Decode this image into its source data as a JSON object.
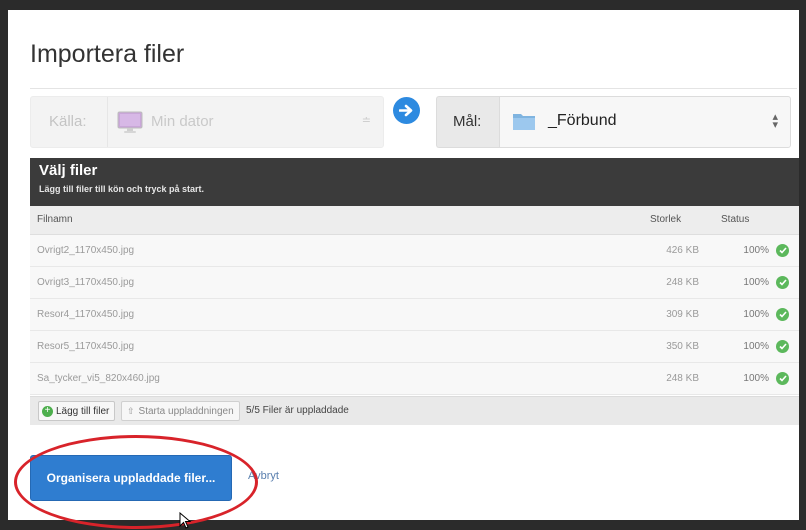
{
  "dialog": {
    "title": "Importera filer"
  },
  "source": {
    "label": "Källa:",
    "value": "Min dator",
    "caret": "≐"
  },
  "destination": {
    "label": "Mål:",
    "value": "_Förbund",
    "caret": "▴▾"
  },
  "file_panel": {
    "title": "Välj filer",
    "subtitle": "Lägg till filer till kön och tryck på start.",
    "columns": {
      "filename": "Filnamn",
      "size": "Storlek",
      "status": "Status"
    },
    "files": [
      {
        "name": "Ovrigt2_1170x450.jpg",
        "size": "426 KB",
        "status": "100%"
      },
      {
        "name": "Ovrigt3_1170x450.jpg",
        "size": "248 KB",
        "status": "100%"
      },
      {
        "name": "Resor4_1170x450.jpg",
        "size": "309 KB",
        "status": "100%"
      },
      {
        "name": "Resor5_1170x450.jpg",
        "size": "350 KB",
        "status": "100%"
      },
      {
        "name": "Sa_tycker_vi5_820x460.jpg",
        "size": "248 KB",
        "status": "100%"
      }
    ],
    "add_button": "Lägg till filer",
    "start_button": "Starta uppladdningen",
    "upload_status": "5/5 Filer är uppladdade"
  },
  "actions": {
    "organize_button": "Organisera uppladdade filer...",
    "cancel_link": "Avbryt"
  },
  "colors": {
    "accent": "#2f7dd0",
    "panel_header": "#3b3b3b",
    "success": "#5cb85c",
    "highlight": "#d8232a"
  },
  "icons": [
    "monitor-icon",
    "arrow-right-icon",
    "folder-icon",
    "check-icon",
    "plus-icon",
    "upload-icon",
    "cursor-icon"
  ]
}
